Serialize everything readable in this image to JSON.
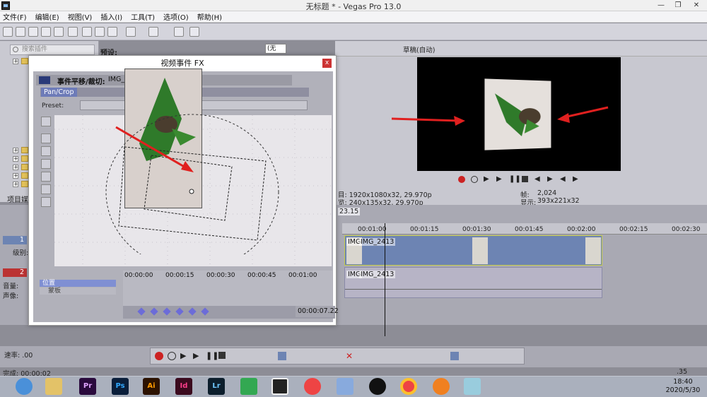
{
  "window": {
    "title": "无标题 * - Vegas Pro 13.0"
  },
  "menu": [
    "文件(F)",
    "编辑(E)",
    "视图(V)",
    "插入(I)",
    "工具(T)",
    "选项(O)",
    "帮助(H)"
  ],
  "explorer": {
    "search_placeholder": "搜索插件",
    "presets_label": "预设:",
    "project_tab": "项目媒"
  },
  "middle": {
    "combo_value": "(无"
  },
  "preview": {
    "quality": "草稿(自动)",
    "project_info": "目: 1920x1080x32, 29.970p",
    "preview_info": "览: 240x135x32, 29.970p",
    "frame_label": "帧:",
    "frame_value": "2,024",
    "display_label": "显示:",
    "display_value": "393x221x32"
  },
  "timeline": {
    "time_badge": "23.15",
    "ruler": [
      "00:01:00",
      "00:01:15",
      "00:01:30",
      "00:01:45",
      "00:02:00",
      "00:02:15",
      "00:02:30"
    ],
    "track1": {
      "num": "1",
      "level_label": "级别:"
    },
    "track2": {
      "num": "2",
      "volume_label": "音量:",
      "pan_label": "声像:"
    },
    "video_clip_1": "IMG",
    "video_clip_2": "IMG_2413",
    "audio_clip_1": "IMG",
    "audio_clip_2": "IMG_2413"
  },
  "transport": {
    "rate": "速率: .00"
  },
  "status": {
    "left": "完成: 00:00:02",
    "right": ".35"
  },
  "taskbar": {
    "apps": [
      "Pr",
      "Ps",
      "Ai",
      "Id",
      "Lr"
    ],
    "time": "18:40",
    "date": "2020/5/30"
  },
  "dialog": {
    "title": "视频事件 FX",
    "close": "x",
    "event_label": "事件平移/裁切:",
    "event_name": "IMG_2413",
    "tab_label": "Pan/Crop",
    "preset_label": "Preset:",
    "timeline_ticks": [
      "00:00:00",
      "00:00:15",
      "00:00:30",
      "00:00:45",
      "00:01:00"
    ],
    "row_position": "位置",
    "row_mask": "蒙板",
    "current_time": "00:00:07.22"
  },
  "colors": {
    "accent": "#6d84b3",
    "clip_border": "#c5cc48",
    "arrow": "#e0201f",
    "leaf": "#2f7a2a"
  }
}
